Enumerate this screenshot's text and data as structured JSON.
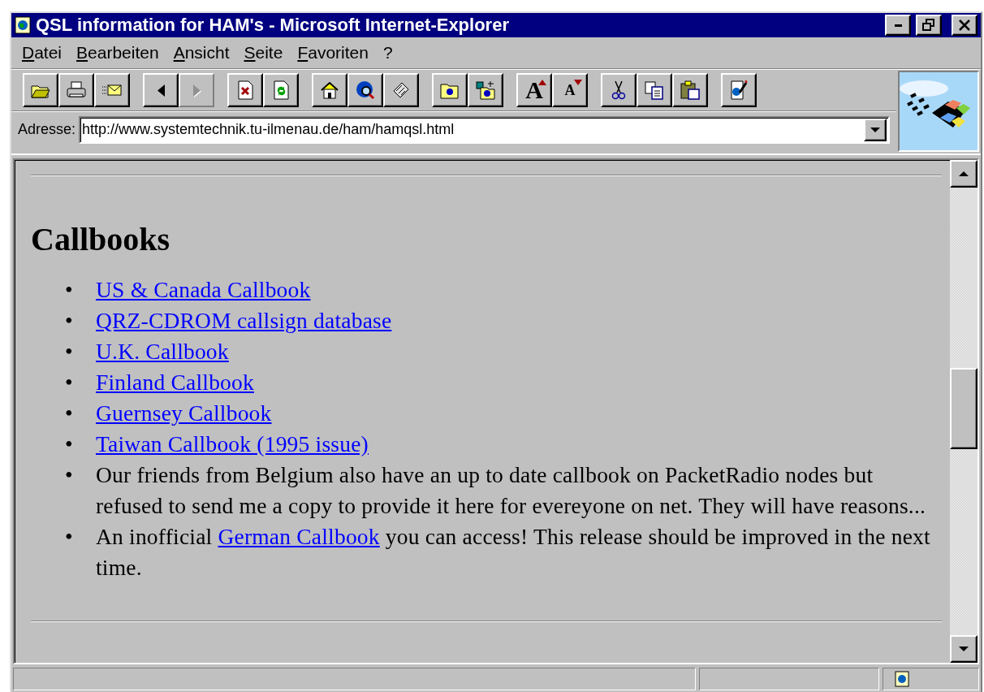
{
  "window": {
    "title": "QSL information for HAM's - Microsoft Internet-Explorer"
  },
  "menu": [
    "Datei",
    "Bearbeiten",
    "Ansicht",
    "Seite",
    "Favoriten",
    "?"
  ],
  "toolbar": [
    [
      {
        "kind": "open",
        "disabled": false
      },
      {
        "kind": "print",
        "disabled": false
      },
      {
        "kind": "mail",
        "disabled": false
      }
    ],
    [
      {
        "kind": "back",
        "disabled": false
      },
      {
        "kind": "forward",
        "disabled": true
      }
    ],
    [
      {
        "kind": "stop",
        "disabled": false
      },
      {
        "kind": "refresh",
        "disabled": false
      }
    ],
    [
      {
        "kind": "home",
        "disabled": false
      },
      {
        "kind": "search",
        "disabled": false
      },
      {
        "kind": "channels",
        "disabled": false
      }
    ],
    [
      {
        "kind": "favorites",
        "disabled": false
      },
      {
        "kind": "add-favorite",
        "disabled": false
      }
    ],
    [
      {
        "kind": "font-larger",
        "label": "A",
        "disabled": false
      },
      {
        "kind": "font-smaller",
        "label": "A",
        "disabled": false
      }
    ],
    [
      {
        "kind": "cut",
        "disabled": false
      },
      {
        "kind": "copy",
        "disabled": false
      },
      {
        "kind": "paste",
        "disabled": false
      }
    ],
    [
      {
        "kind": "edit",
        "disabled": false
      }
    ]
  ],
  "address": {
    "label": "Adresse:",
    "value": "http://www.systemtechnik.tu-ilmenau.de/ham/hamqsl.html"
  },
  "page": {
    "heading": "Callbooks",
    "items": [
      {
        "bullet": "•",
        "parts": [
          {
            "text": "US & Canada Callbook",
            "link": true
          }
        ]
      },
      {
        "bullet": "•",
        "parts": [
          {
            "text": "QRZ-CDROM callsign database",
            "link": true
          }
        ]
      },
      {
        "bullet": "•",
        "parts": [
          {
            "text": "U.K. Callbook",
            "link": true
          }
        ]
      },
      {
        "bullet": "•",
        "parts": [
          {
            "text": "Finland Callbook",
            "link": true
          }
        ]
      },
      {
        "bullet": "•",
        "parts": [
          {
            "text": "Guernsey Callbook",
            "link": true
          }
        ]
      },
      {
        "bullet": "•",
        "parts": [
          {
            "text": "Taiwan Callbook (1995 issue)",
            "link": true
          }
        ]
      },
      {
        "bullet": "•",
        "parts": [
          {
            "text": "Our friends from Belgium also have an up to date callbook on PacketRadio nodes but refused to send me a copy to provide it here for evereyone on net. They will have reasons...",
            "link": false
          }
        ]
      },
      {
        "bullet": "•",
        "parts": [
          {
            "text": "An inofficial ",
            "link": false
          },
          {
            "text": "German Callbook",
            "link": true
          },
          {
            "text": " you can access! This release should be improved in the next time.",
            "link": false
          }
        ]
      }
    ]
  }
}
